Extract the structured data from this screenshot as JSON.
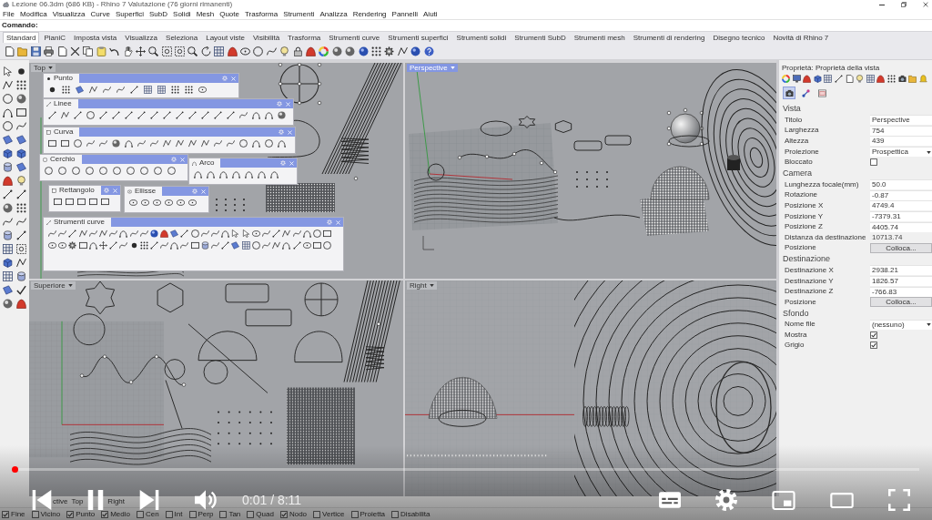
{
  "window": {
    "title": "Lezione 06.3dm (686 KB) - Rhino 7 Valutazione (76 giorni rimanenti)"
  },
  "menu": [
    "File",
    "Modifica",
    "Visualizza",
    "Curve",
    "Superfici",
    "SubD",
    "Solidi",
    "Mesh",
    "Quote",
    "Trasforma",
    "Strumenti",
    "Analizza",
    "Rendering",
    "Pannelli",
    "Aiuti"
  ],
  "command": {
    "prompt": "Comando:"
  },
  "toolbar_tabs": [
    {
      "label": "Standard",
      "selected": true
    },
    {
      "label": "PianiC",
      "selected": false
    },
    {
      "label": "Imposta vista",
      "selected": false
    },
    {
      "label": "Visualizza",
      "selected": false
    },
    {
      "label": "Seleziona",
      "selected": false
    },
    {
      "label": "Layout viste",
      "selected": false
    },
    {
      "label": "Visibilità",
      "selected": false
    },
    {
      "label": "Trasforma",
      "selected": false
    },
    {
      "label": "Strumenti curve",
      "selected": false
    },
    {
      "label": "Strumenti superfici",
      "selected": false
    },
    {
      "label": "Strumenti solidi",
      "selected": false
    },
    {
      "label": "Strumenti SubD",
      "selected": false
    },
    {
      "label": "Strumenti mesh",
      "selected": false
    },
    {
      "label": "Strumenti di rendering",
      "selected": false
    },
    {
      "label": "Disegno tecnico",
      "selected": false
    },
    {
      "label": "Novità di Rhino 7",
      "selected": false
    }
  ],
  "viewports": [
    {
      "label": "Top",
      "selected": false
    },
    {
      "label": "Perspective",
      "selected": true
    },
    {
      "label": "Superiore",
      "selected": false
    },
    {
      "label": "Right",
      "selected": false
    }
  ],
  "floating_toolbars": [
    {
      "title": "Punto"
    },
    {
      "title": "Linee"
    },
    {
      "title": "Curva"
    },
    {
      "title": "Cerchio"
    },
    {
      "title": "Arco"
    },
    {
      "title": "Rettangolo"
    },
    {
      "title": "Ellisse"
    },
    {
      "title": "Strumenti curve"
    }
  ],
  "properties": {
    "title": "Proprietà: Proprietà della vista",
    "page_buttons": [
      {
        "selected": true
      },
      {
        "selected": false
      },
      {
        "selected": false
      }
    ],
    "sections": [
      {
        "title": "Vista",
        "rows": [
          {
            "label": "Titolo",
            "kind": "field",
            "value": "Perspective"
          },
          {
            "label": "Larghezza",
            "kind": "field",
            "value": "754"
          },
          {
            "label": "Altezza",
            "kind": "field",
            "value": "439"
          },
          {
            "label": "Proiezione",
            "kind": "dropdown",
            "value": "Prospettica"
          },
          {
            "label": "Bloccato",
            "kind": "checkbox",
            "checked": false
          }
        ]
      },
      {
        "title": "Camera",
        "rows": [
          {
            "label": "Lunghezza focale(mm)",
            "kind": "field",
            "value": "50.0"
          },
          {
            "label": "Rotazione",
            "kind": "field",
            "value": "-0.87"
          },
          {
            "label": "Posizione X",
            "kind": "field",
            "value": "4749.4"
          },
          {
            "label": "Posizione Y",
            "kind": "field",
            "value": "-7379.31"
          },
          {
            "label": "Posizione Z",
            "kind": "field",
            "value": "4405.74"
          },
          {
            "label": "Distanza da destinazione",
            "kind": "text",
            "value": "10713.74"
          },
          {
            "label": "Posizione",
            "kind": "button",
            "value": "Colloca..."
          }
        ]
      },
      {
        "title": "Destinazione",
        "rows": [
          {
            "label": "Destinazione X",
            "kind": "field",
            "value": "2938.21"
          },
          {
            "label": "Destinazione Y",
            "kind": "field",
            "value": "1826.57"
          },
          {
            "label": "Destinazione Z",
            "kind": "field",
            "value": "-766.83"
          },
          {
            "label": "Posizione",
            "kind": "button",
            "value": "Colloca..."
          }
        ]
      },
      {
        "title": "Sfondo",
        "rows": [
          {
            "label": "Nome file",
            "kind": "dropdown",
            "value": "(nessuno)"
          },
          {
            "label": "Mostra",
            "kind": "checkbox",
            "checked": true
          },
          {
            "label": "Grigio",
            "kind": "checkbox",
            "checked": true
          }
        ]
      }
    ]
  },
  "viewport_tabs": [
    "ctive",
    "Top",
    "Right"
  ],
  "snaps": [
    {
      "label": "Fine",
      "checked": true
    },
    {
      "label": "Vicino",
      "checked": false
    },
    {
      "label": "Punto",
      "checked": true
    },
    {
      "label": "Medio",
      "checked": true
    },
    {
      "label": "Cen",
      "checked": false
    },
    {
      "label": "Int",
      "checked": false
    },
    {
      "label": "Perp",
      "checked": false
    },
    {
      "label": "Tan",
      "checked": false
    },
    {
      "label": "Quad",
      "checked": false
    },
    {
      "label": "Nodo",
      "checked": true
    },
    {
      "label": "Vertice",
      "checked": false
    },
    {
      "label": "Proietta",
      "checked": false
    },
    {
      "label": "Disabilita",
      "checked": false
    }
  ],
  "player": {
    "progress": {
      "level": 0.002
    },
    "time": "0:01 / 8:11"
  }
}
